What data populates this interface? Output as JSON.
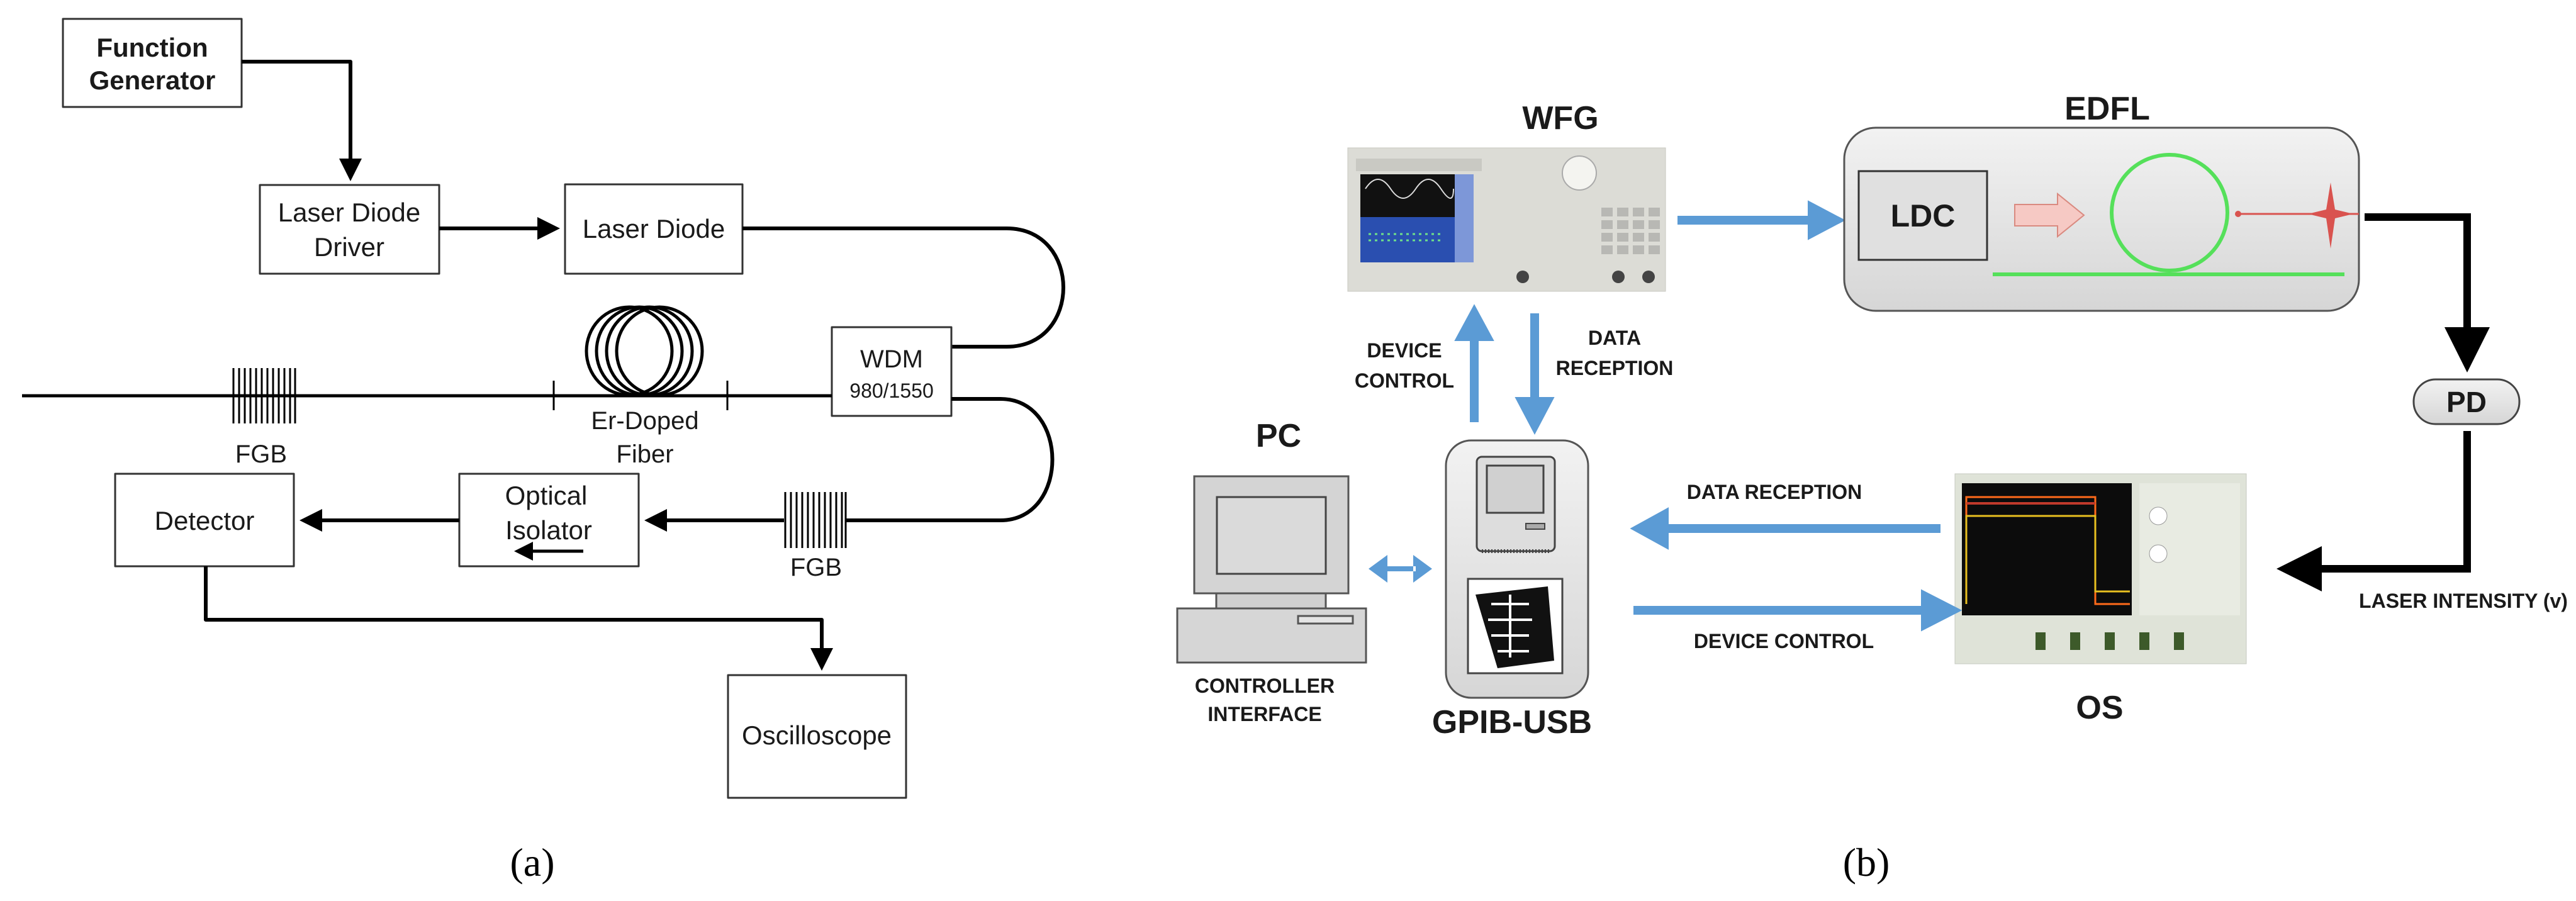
{
  "panel_a": {
    "caption": "(a)",
    "function_generator": [
      "Function",
      "Generator"
    ],
    "laser_diode_driver": [
      "Laser Diode",
      "Driver"
    ],
    "laser_diode": "Laser Diode",
    "wdm": [
      "WDM",
      "980/1550"
    ],
    "fgb_left": "FGB",
    "er_doped_fiber": [
      "Er-Doped",
      "Fiber"
    ],
    "fgb_right": "FGB",
    "optical_isolator": [
      "Optical",
      "Isolator"
    ],
    "detector": "Detector",
    "oscilloscope": "Oscilloscope"
  },
  "panel_b": {
    "caption": "(b)",
    "wfg": "WFG",
    "edfl": "EDFL",
    "ldc": "LDC",
    "pd": "PD",
    "laser_intensity": "LASER INTENSITY (v)",
    "pc": "PC",
    "controller_interface": [
      "CONTROLLER",
      "INTERFACE"
    ],
    "gpib_usb": "GPIB-USB",
    "device_control_vertical": [
      "DEVICE",
      "CONTROL"
    ],
    "data_reception_vertical": [
      "DATA",
      "RECEPTION"
    ],
    "data_reception": "DATA RECEPTION",
    "device_control": "DEVICE CONTROL",
    "os": "OS"
  },
  "colors": {
    "blue_arrow": "#5b9bd5",
    "fiber_green": "#55e05a",
    "pump_arrow_pink": "#f6c9c4",
    "output_red": "#d9534f",
    "box_gray": "#e3e3e3"
  }
}
